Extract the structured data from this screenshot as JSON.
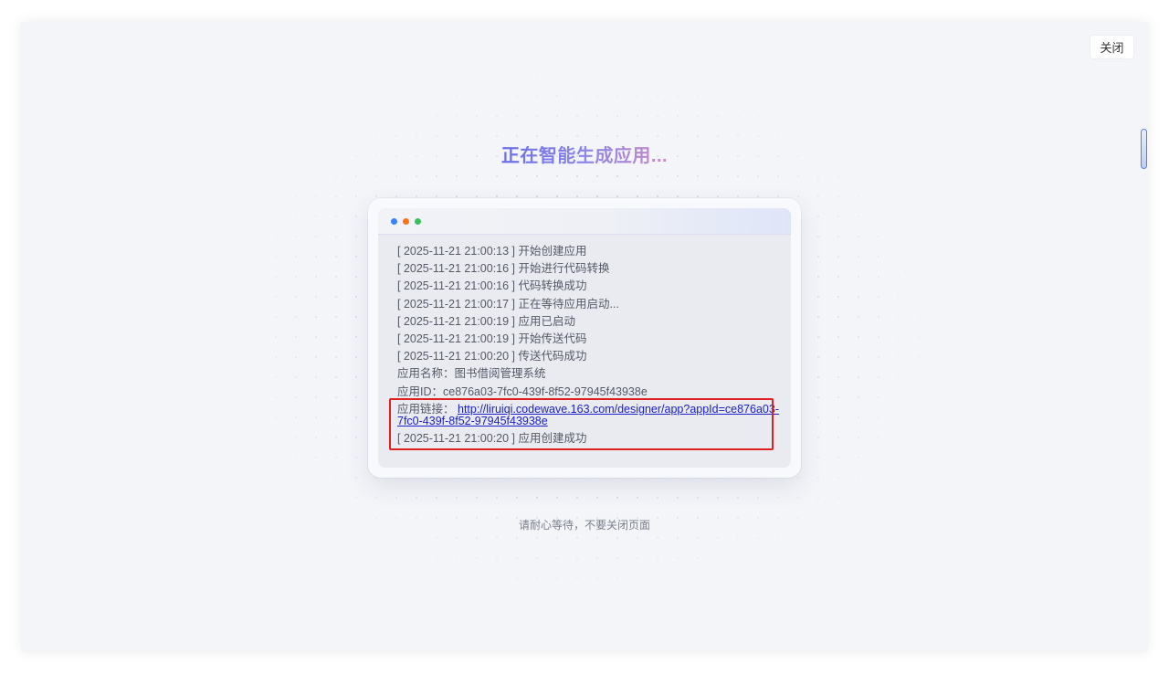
{
  "close_label": "关闭",
  "title": "正在智能生成应用...",
  "logs": [
    "[ 2025-11-21 21:00:13 ] 开始创建应用",
    "[ 2025-11-21 21:00:16 ] 开始进行代码转换",
    "[ 2025-11-21 21:00:16 ] 代码转换成功",
    "[ 2025-11-21 21:00:17 ] 正在等待应用启动...",
    "[ 2025-11-21 21:00:19 ] 应用已启动",
    "[ 2025-11-21 21:00:19 ] 开始传送代码",
    "[ 2025-11-21 21:00:20 ] 传送代码成功",
    "应用名称：图书借阅管理系统",
    "应用ID：ce876a03-7fc0-439f-8f52-97945f43938e"
  ],
  "app_link": {
    "label": "应用链接：",
    "url": "http://liruiqi.codewave.163.com/designer/app?appId=ce876a03-7fc0-439f-8f52-97945f43938e"
  },
  "final_log": "[ 2025-11-21 21:00:20 ] 应用创建成功",
  "hint": "请耐心等待，不要关闭页面",
  "window_dots": {
    "colors": [
      "#3b82f6",
      "#f97316",
      "#3cbf5c"
    ]
  }
}
